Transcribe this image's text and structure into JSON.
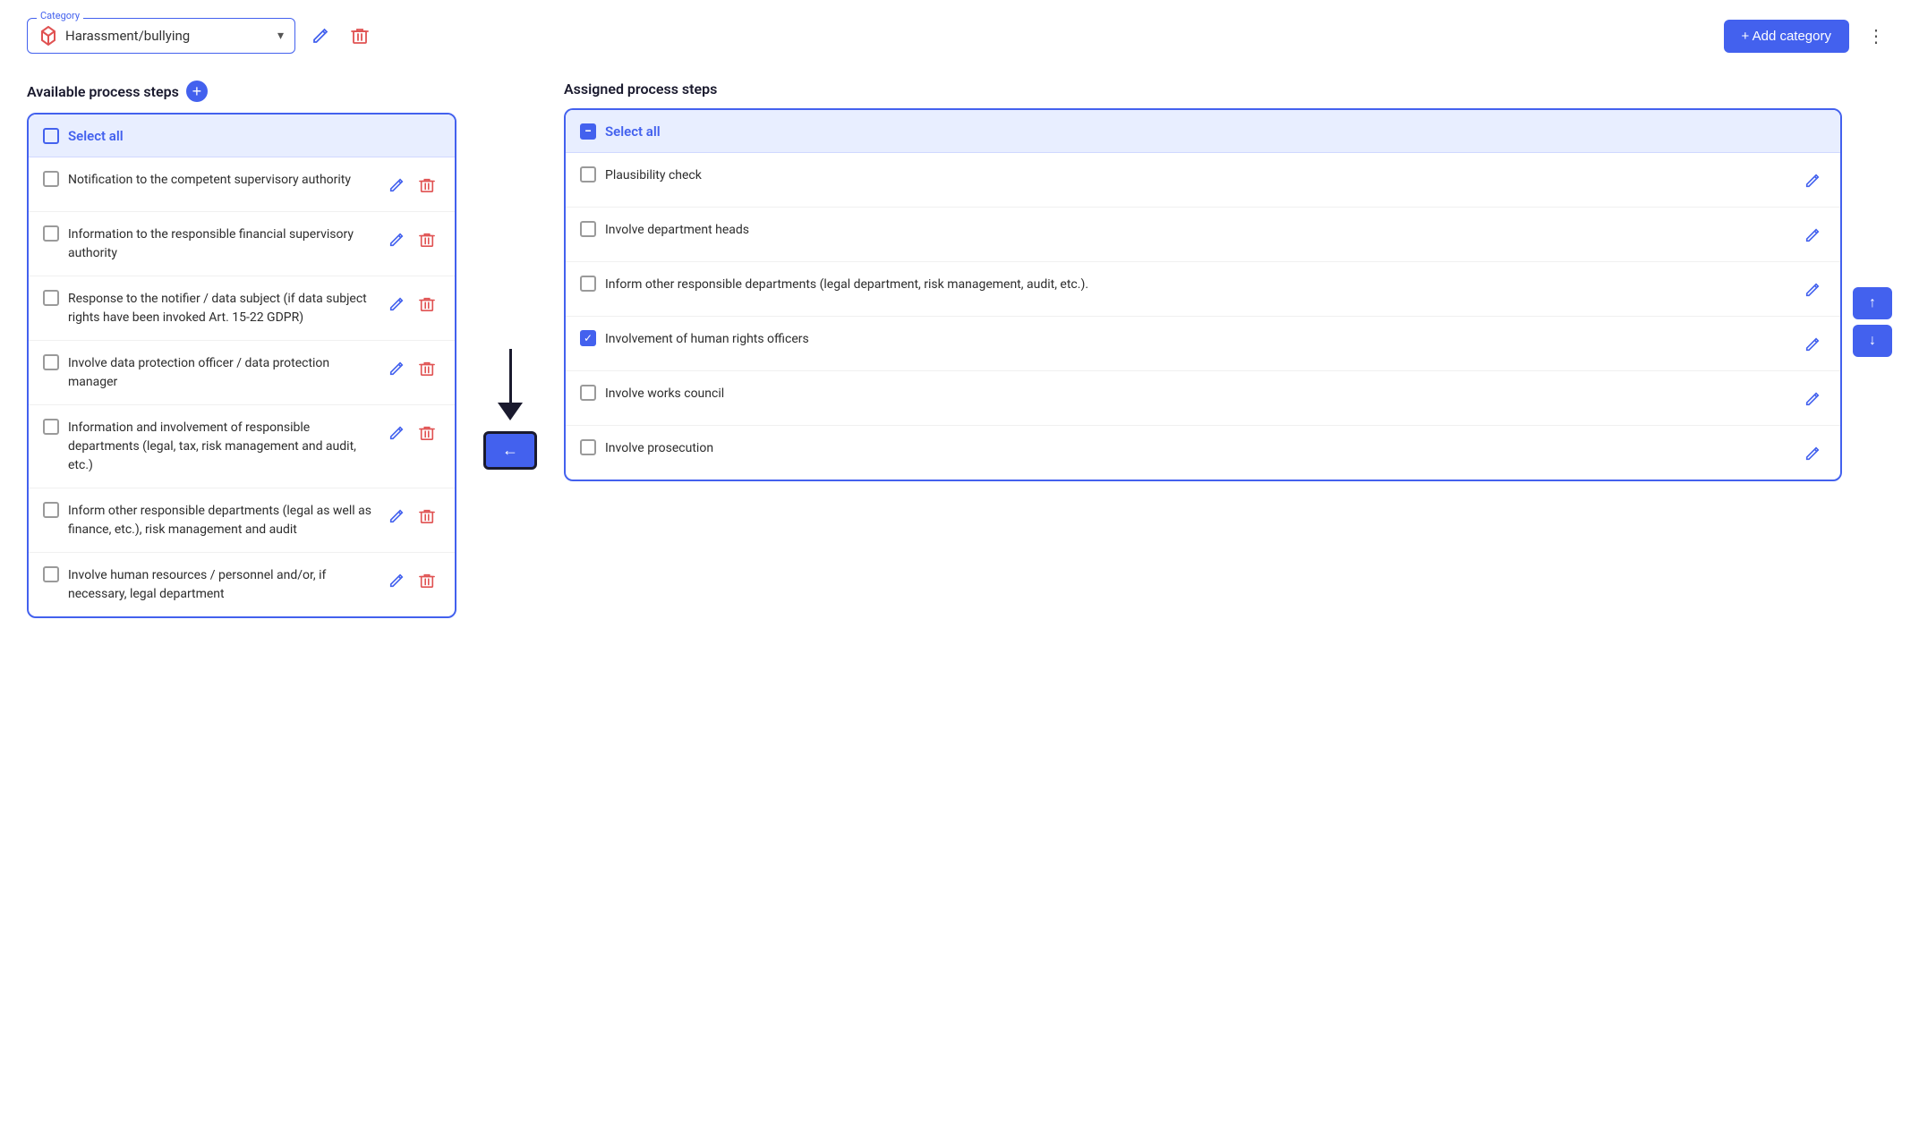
{
  "header": {
    "category_label": "Category",
    "category_value": "Harassment/bullying",
    "edit_tooltip": "Edit",
    "delete_tooltip": "Delete",
    "add_category_label": "+ Add category",
    "more_options_label": "⋮"
  },
  "available_panel": {
    "title": "Available process steps",
    "select_all_label": "Select all",
    "items": [
      {
        "id": 1,
        "text": "Notification to the competent supervisory authority",
        "checked": false
      },
      {
        "id": 2,
        "text": "Information to the responsible financial supervisory authority",
        "checked": false
      },
      {
        "id": 3,
        "text": "Response to the notifier / data subject (if data subject rights have been invoked Art. 15-22 GDPR)",
        "checked": false
      },
      {
        "id": 4,
        "text": "Involve data protection officer / data protection manager",
        "checked": false
      },
      {
        "id": 5,
        "text": "Information and involvement of responsible departments (legal, tax, risk management and audit, etc.)",
        "checked": false
      },
      {
        "id": 6,
        "text": "Inform other responsible departments (legal as well as finance, etc.), risk management and audit",
        "checked": false
      },
      {
        "id": 7,
        "text": "Involve human resources / personnel and/or, if necessary, legal department",
        "checked": false
      }
    ]
  },
  "assigned_panel": {
    "title": "Assigned process steps",
    "select_all_label": "Select all",
    "items": [
      {
        "id": 1,
        "text": "Plausibility check",
        "checked": false
      },
      {
        "id": 2,
        "text": "Involve department heads",
        "checked": false
      },
      {
        "id": 3,
        "text": "Inform other responsible departments (legal department, risk management, audit, etc.).",
        "checked": false
      },
      {
        "id": 4,
        "text": "Involvement of human rights officers",
        "checked": true
      },
      {
        "id": 5,
        "text": "Involve works council",
        "checked": false
      },
      {
        "id": 6,
        "text": "Involve prosecution",
        "checked": false
      }
    ]
  },
  "controls": {
    "transfer_btn_label": "←",
    "up_btn_label": "↑",
    "down_btn_label": "↓"
  }
}
